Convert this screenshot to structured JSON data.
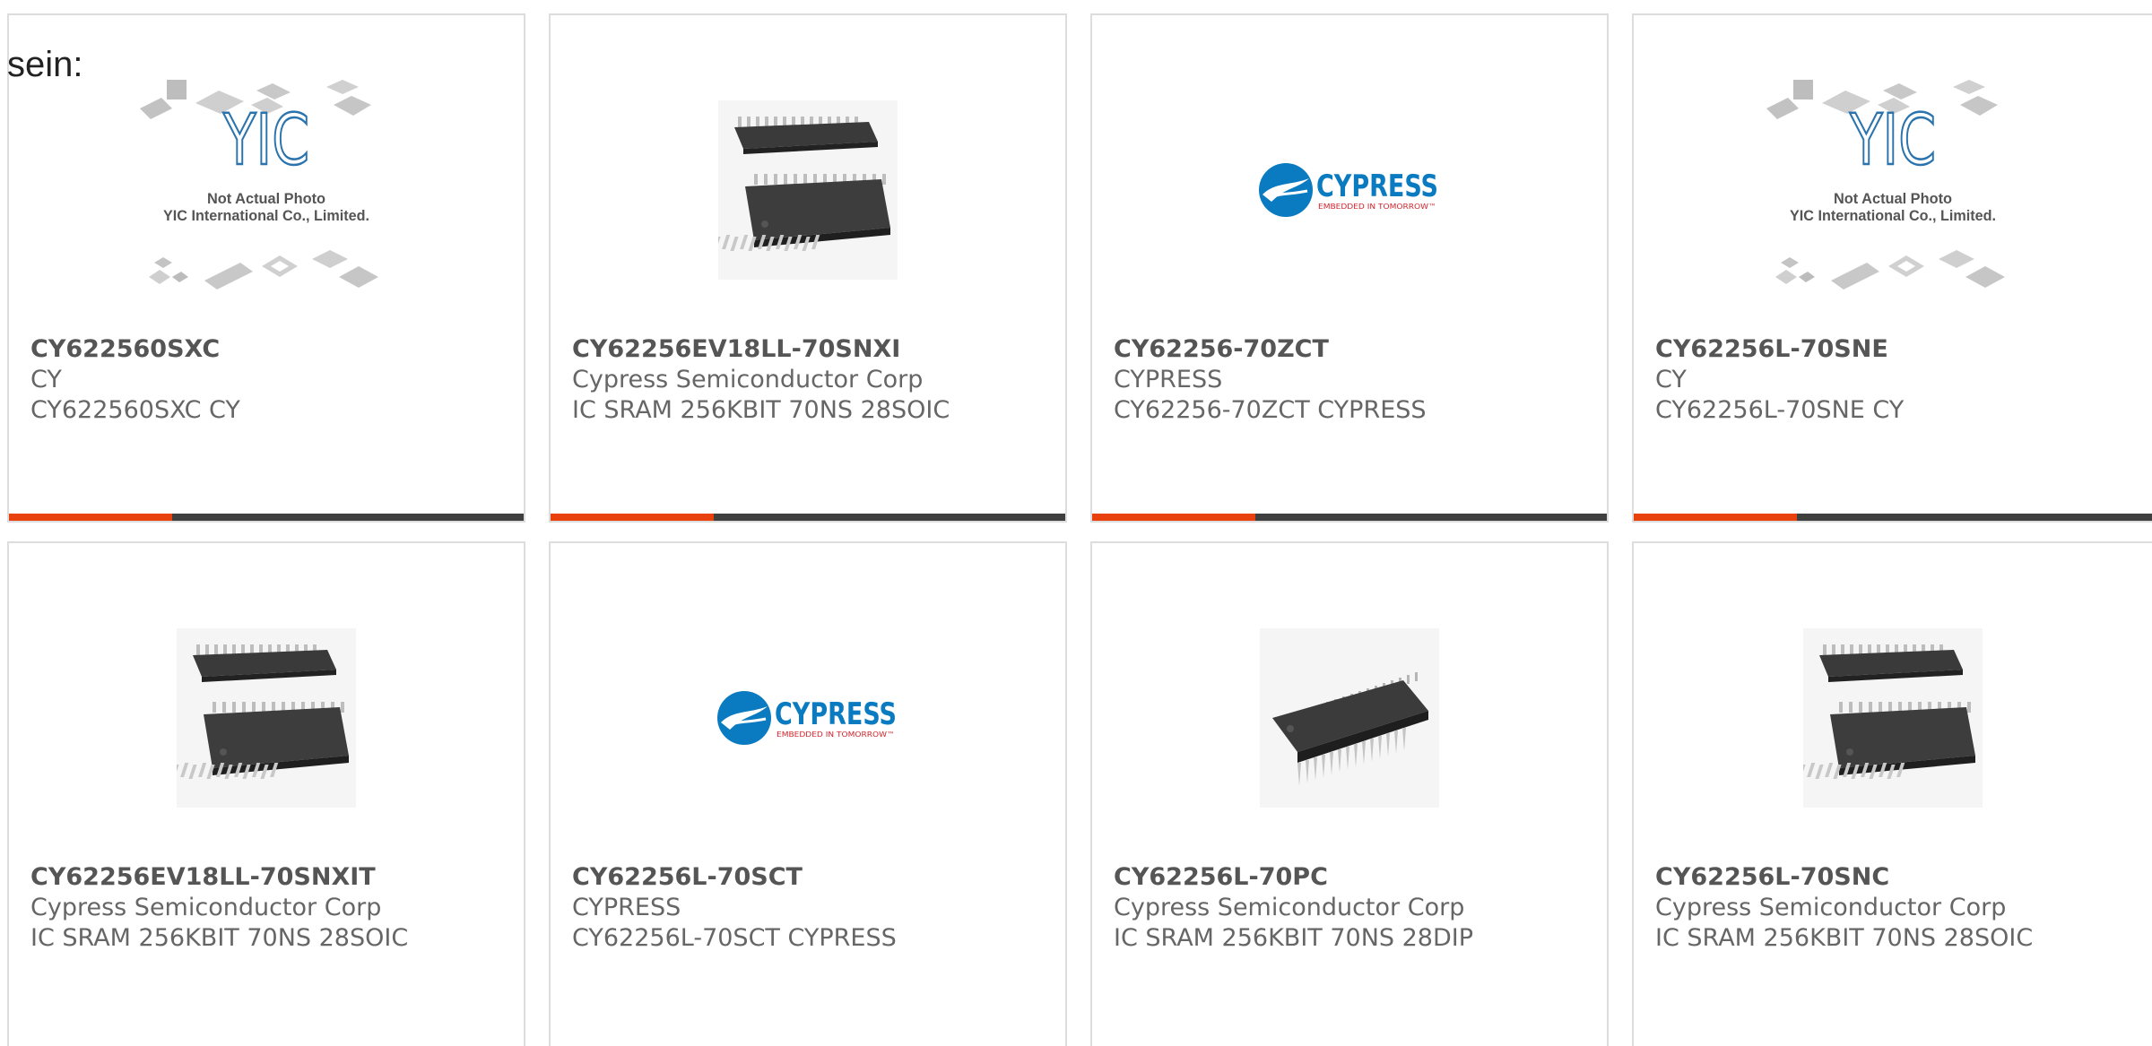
{
  "intro_text": "sein:",
  "placeholder_notice": {
    "brand": "YIC",
    "line1": "Not Actual Photo",
    "line2": "YIC International Co., Limited."
  },
  "cypress_logo": {
    "word": "CYPRESS",
    "tagline": "EMBEDDED IN TOMORROW™"
  },
  "colors": {
    "accent": "#e8410e",
    "bar": "#3f3f3f",
    "cypress_blue": "#0a7bc1",
    "cypress_red": "#d1232a"
  },
  "products": [
    {
      "part": "CY622560SXC",
      "manufacturer": "CY",
      "description": "CY622560SXC CY",
      "image": "not-actual-photo"
    },
    {
      "part": "CY62256EV18LL-70SNXI",
      "manufacturer": "Cypress Semiconductor Corp",
      "description": "IC SRAM 256KBIT 70NS 28SOIC",
      "image": "soic-chip"
    },
    {
      "part": "CY62256-70ZCT",
      "manufacturer": "CYPRESS",
      "description": "CY62256-70ZCT CYPRESS",
      "image": "cypress-logo"
    },
    {
      "part": "CY62256L-70SNE",
      "manufacturer": "CY",
      "description": "CY62256L-70SNE CY",
      "image": "not-actual-photo"
    },
    {
      "part": "CY62256EV18LL-70SNXIT",
      "manufacturer": "Cypress Semiconductor Corp",
      "description": "IC SRAM 256KBIT 70NS 28SOIC",
      "image": "soic-chip"
    },
    {
      "part": "CY62256L-70SCT",
      "manufacturer": "CYPRESS",
      "description": "CY62256L-70SCT CYPRESS",
      "image": "cypress-logo"
    },
    {
      "part": "CY62256L-70PC",
      "manufacturer": "Cypress Semiconductor Corp",
      "description": "IC SRAM 256KBIT 70NS 28DIP",
      "image": "dip-chip"
    },
    {
      "part": "CY62256L-70SNC",
      "manufacturer": "Cypress Semiconductor Corp",
      "description": "IC SRAM 256KBIT 70NS 28SOIC",
      "image": "soic-chip"
    }
  ]
}
